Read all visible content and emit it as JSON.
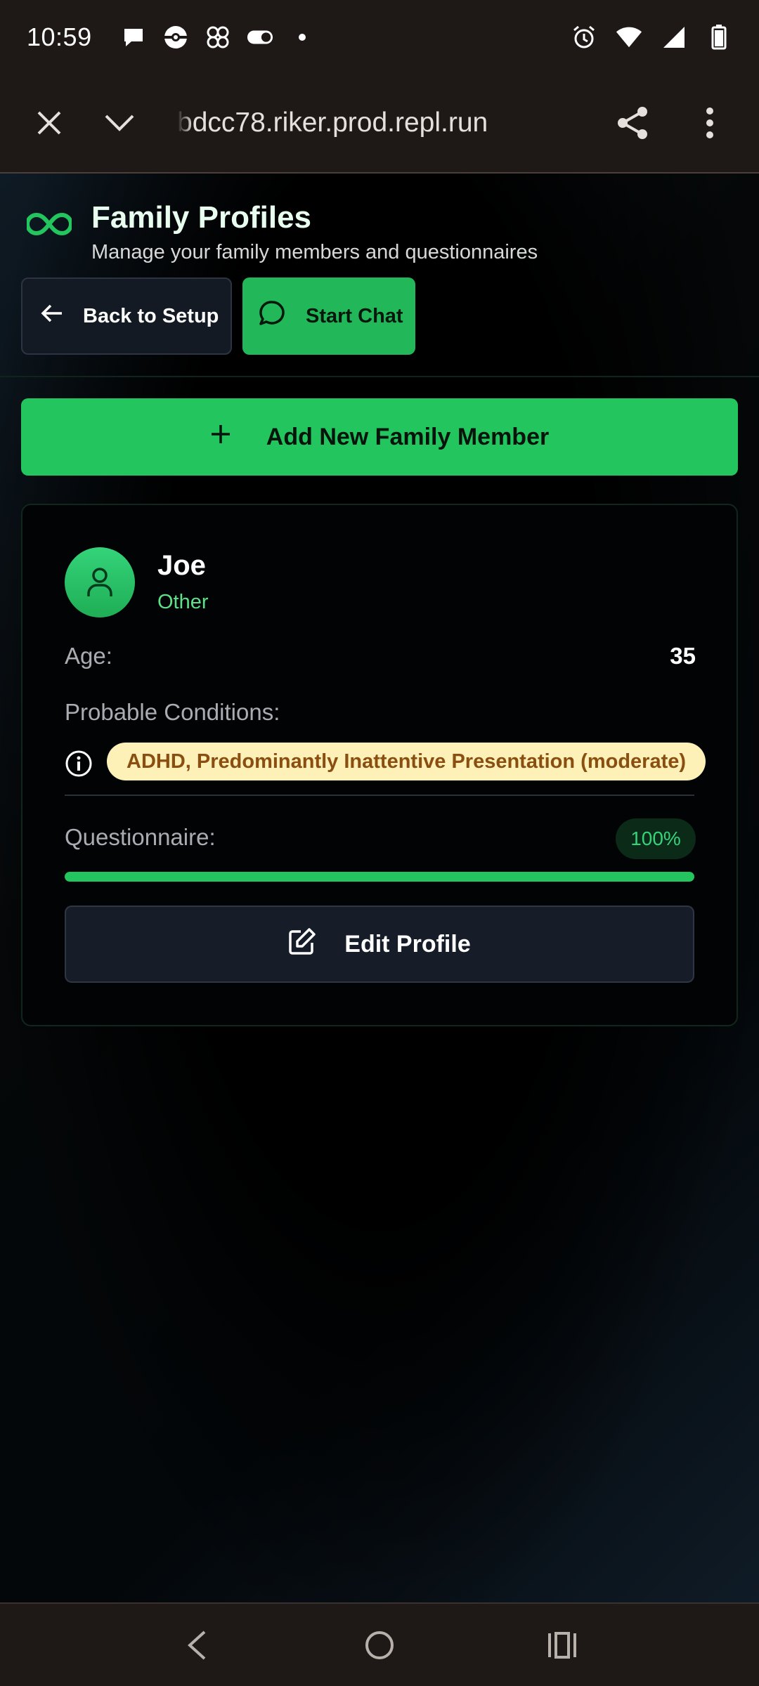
{
  "status_bar": {
    "time": "10:59",
    "left_icons": [
      "chat-bubble-icon",
      "pokeball-icon",
      "pinwheel-icon",
      "toggle-icon",
      "dot-icon"
    ],
    "right_icons": [
      "alarm-icon",
      "wifi-icon",
      "signal-icon",
      "battery-icon"
    ]
  },
  "browser": {
    "url": "bdcc78.riker.prod.repl.run"
  },
  "header": {
    "title": "Family Profiles",
    "subtitle": "Manage your family members and questionnaires",
    "back_label": "Back to Setup",
    "chat_label": "Start Chat"
  },
  "actions": {
    "add_member_label": "Add New Family Member"
  },
  "member": {
    "name": "Joe",
    "relation": "Other",
    "age_label": "Age:",
    "age": "35",
    "conditions_label": "Probable Conditions:",
    "condition": "ADHD, Predominantly Inattentive Presentation (moderate)",
    "questionnaire_label": "Questionnaire:",
    "questionnaire_percent": "100%",
    "questionnaire_progress": 1.0,
    "edit_label": "Edit Profile"
  },
  "colors": {
    "accent": "#22c55e",
    "badge_bg": "#fdf1b8",
    "badge_text": "#8a4f10"
  }
}
